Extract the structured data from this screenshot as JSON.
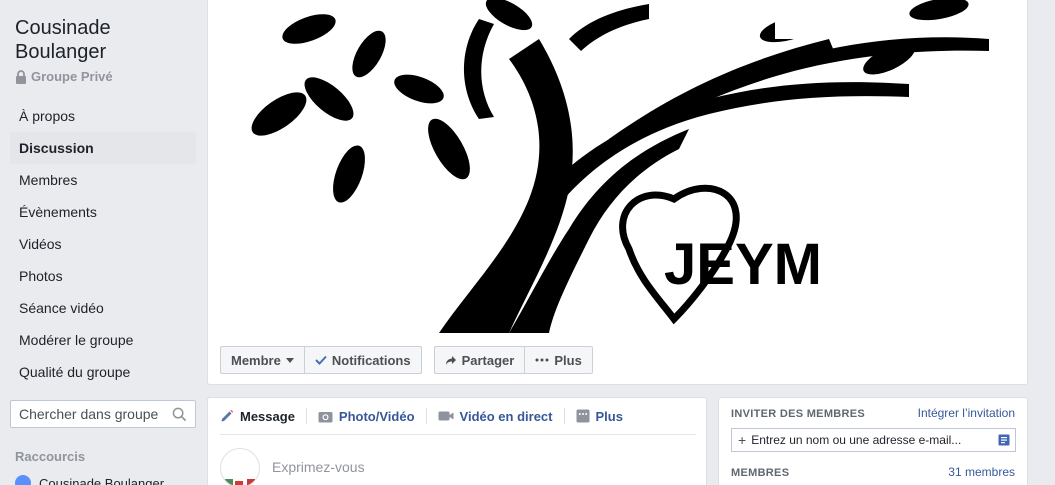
{
  "group": {
    "name": "Cousinade Boulanger",
    "privacy": "Groupe Privé"
  },
  "nav": {
    "items": [
      {
        "label": "À propos"
      },
      {
        "label": "Discussion"
      },
      {
        "label": "Membres"
      },
      {
        "label": "Évènements"
      },
      {
        "label": "Vidéos"
      },
      {
        "label": "Photos"
      },
      {
        "label": "Séance vidéo"
      },
      {
        "label": "Modérer le groupe"
      },
      {
        "label": "Qualité du groupe"
      }
    ],
    "active_index": 1
  },
  "search": {
    "placeholder": "Chercher dans groupe"
  },
  "shortcuts": {
    "title": "Raccourcis",
    "items": [
      {
        "label": "Cousinade Boulanger"
      }
    ]
  },
  "cover": {
    "monogram": "JEYM"
  },
  "actions": {
    "member_label": "Membre",
    "notifications_label": "Notifications",
    "share_label": "Partager",
    "more_label": "Plus"
  },
  "composer": {
    "tabs": {
      "message": "Message",
      "photo_video": "Photo/Vidéo",
      "live_video": "Vidéo en direct",
      "more": "Plus"
    },
    "placeholder": "Exprimez-vous"
  },
  "invite": {
    "title": "INVITER DES MEMBRES",
    "embed_link": "Intégrer l’invitation",
    "input_placeholder": "Entrez un nom ou une adresse e-mail..."
  },
  "members": {
    "title": "MEMBRES",
    "count": "31 membres"
  },
  "colors": {
    "link": "#365899",
    "background": "#e9ebee",
    "active_nav": "#e4e6ea"
  }
}
